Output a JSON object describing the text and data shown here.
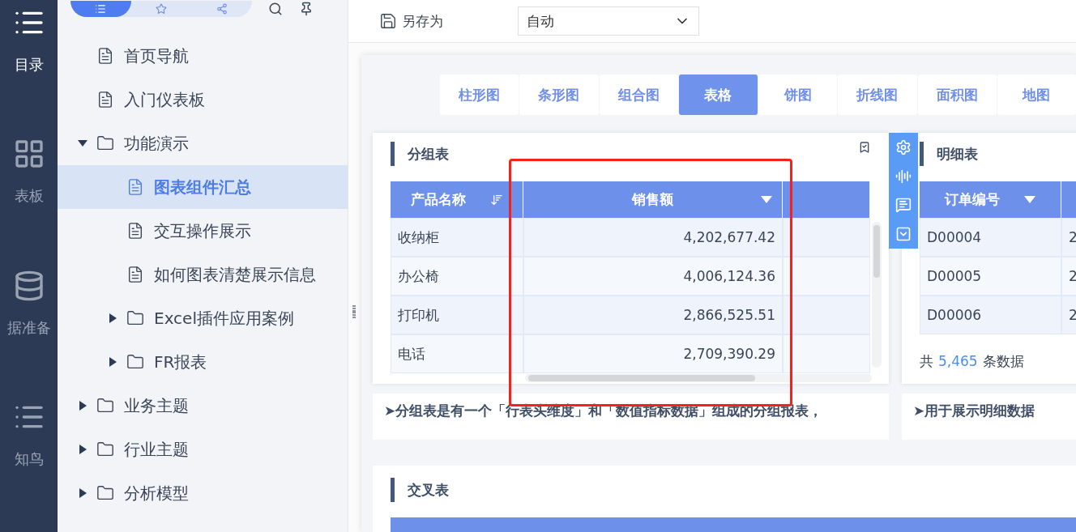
{
  "rail": [
    {
      "label": "目录",
      "selected": true
    },
    {
      "label": "表板",
      "selected": false
    },
    {
      "label": "据准备",
      "selected": false
    },
    {
      "label": "知鸟",
      "selected": false
    }
  ],
  "sidebar": {
    "tabs": [
      {
        "selected": true
      },
      {
        "selected": false
      },
      {
        "selected": false
      }
    ],
    "tree": [
      {
        "label": "首页导航",
        "kind": "doc",
        "selected": false
      },
      {
        "label": "入门仪表板",
        "kind": "doc",
        "selected": false
      },
      {
        "label": "功能演示",
        "kind": "folder",
        "expanded": true,
        "selected": false,
        "children": [
          {
            "label": "图表组件汇总",
            "kind": "doc",
            "selected": true
          },
          {
            "label": "交互操作展示",
            "kind": "doc",
            "selected": false
          },
          {
            "label": "如何图表清楚展示信息",
            "kind": "doc",
            "selected": false
          },
          {
            "label": "Excel插件应用案例",
            "kind": "folder",
            "expanded": false,
            "selected": false
          },
          {
            "label": "FR报表",
            "kind": "folder",
            "expanded": false,
            "selected": false
          }
        ]
      },
      {
        "label": "业务主题",
        "kind": "folder",
        "expanded": false,
        "selected": false
      },
      {
        "label": "行业主题",
        "kind": "folder",
        "expanded": false,
        "selected": false
      },
      {
        "label": "分析模型",
        "kind": "folder",
        "expanded": false,
        "selected": false
      }
    ]
  },
  "toolbar": {
    "save_as": "另存为",
    "mode_select": "自动"
  },
  "chart_tabs": [
    {
      "label": "柱形图",
      "selected": false
    },
    {
      "label": "条形图",
      "selected": false
    },
    {
      "label": "组合图",
      "selected": false
    },
    {
      "label": "表格",
      "selected": true
    },
    {
      "label": "饼图",
      "selected": false
    },
    {
      "label": "折线图",
      "selected": false
    },
    {
      "label": "面积图",
      "selected": false
    },
    {
      "label": "地图",
      "selected": false
    }
  ],
  "group_table": {
    "title": "分组表",
    "columns": [
      "产品名称",
      "销售额"
    ],
    "rows": [
      {
        "name": "收纳柜",
        "sales": "4,202,677.42"
      },
      {
        "name": "办公椅",
        "sales": "4,006,124.36"
      },
      {
        "name": "打印机",
        "sales": "2,866,525.51"
      },
      {
        "name": "电话",
        "sales": "2,709,390.29"
      }
    ],
    "description": "➤分组表是有一个「行表头维度」和「数值指标数据」组成的分组报表，"
  },
  "detail_table": {
    "title": "明细表",
    "columns": [
      "订单编号"
    ],
    "rows": [
      {
        "id": "D00004",
        "column_2": "2"
      },
      {
        "id": "D00005",
        "column_2": "2"
      },
      {
        "id": "D00006",
        "column_2": "2"
      }
    ],
    "footer": {
      "prefix": "共",
      "count": "5,465",
      "suffix": "条数据"
    },
    "description": "➤用于展示明细数据"
  },
  "cross_table": {
    "title": "交叉表"
  }
}
